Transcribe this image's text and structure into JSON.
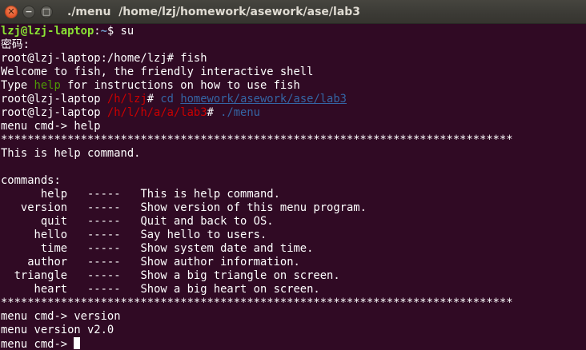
{
  "window": {
    "title": "./menu  /home/lzj/homework/asework/ase/lab3",
    "close_glyph": "✕",
    "minimize_glyph": "−",
    "maximize_glyph": "□"
  },
  "colors": {
    "background": "#300a24",
    "foreground": "#ffffff",
    "prompt_green": "#8ae234",
    "prompt_blue": "#729fcf",
    "fish_red": "#cc0000",
    "fish_blue": "#3465a4",
    "fish_green": "#4e9a06"
  },
  "terminal": {
    "su_prompt_user": "lzj@lzj-laptop",
    "su_prompt_sep": ":",
    "su_prompt_path": "~",
    "su_prompt_tail": "$ su",
    "password_prompt": "密码:",
    "root_prompt": "root@lzj-laptop:/home/lzj# fish",
    "welcome": "Welcome to fish, the friendly interactive shell",
    "type_pre": "Type ",
    "type_help": "help",
    "type_post": " for instructions on how to use fish",
    "fish1_host": "root@lzj-laptop ",
    "fish1_path": "/h/lzj",
    "fish1_hash": "# ",
    "fish1_cmd": "cd",
    "fish1_space": " ",
    "fish1_arg": "homework/asework/ase/lab3",
    "fish2_host": "root@lzj-laptop ",
    "fish2_path": "/h/l/h/a/a/lab3",
    "fish2_hash": "# ",
    "fish2_cmd": "./menu",
    "menu_cmd_help": "menu cmd-> help",
    "stars": "*****************************************************************************",
    "help_desc": "This is help command.",
    "blank": "",
    "commands_label": "commands:",
    "commands": [
      {
        "name": "      help",
        "sep": "   -----   ",
        "desc": "This is help command."
      },
      {
        "name": "   version",
        "sep": "   -----   ",
        "desc": "Show version of this menu program."
      },
      {
        "name": "      quit",
        "sep": "   -----   ",
        "desc": "Quit and back to OS."
      },
      {
        "name": "     hello",
        "sep": "   -----   ",
        "desc": "Say hello to users."
      },
      {
        "name": "      time",
        "sep": "   -----   ",
        "desc": "Show system date and time."
      },
      {
        "name": "    author",
        "sep": "   -----   ",
        "desc": "Show author information."
      },
      {
        "name": "  triangle",
        "sep": "   -----   ",
        "desc": "Show a big triangle on screen."
      },
      {
        "name": "     heart",
        "sep": "   -----   ",
        "desc": "Show a big heart on screen."
      }
    ],
    "stars_end": "*****************************************************************************",
    "menu_cmd_version": "menu cmd-> version",
    "version_output": "menu version v2.0",
    "menu_cmd_current": "menu cmd-> "
  }
}
